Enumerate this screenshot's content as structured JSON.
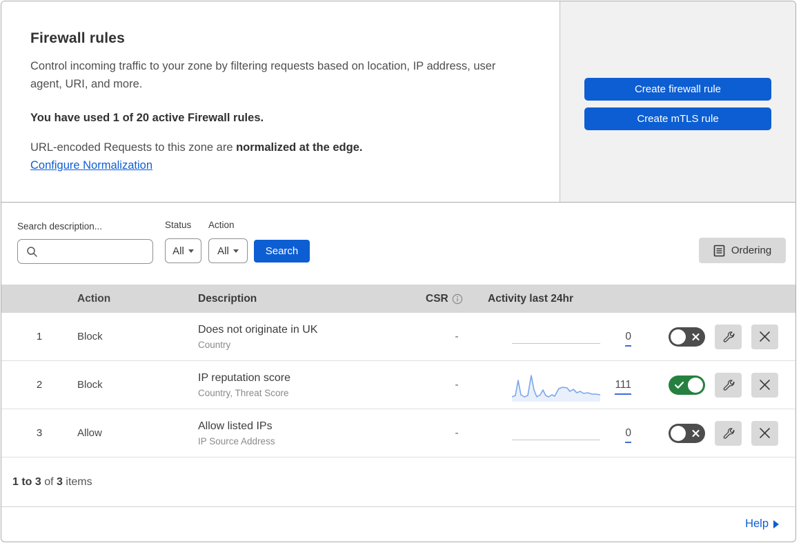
{
  "hero": {
    "title": "Firewall rules",
    "description": "Control incoming traffic to your zone by filtering requests based on location, IP address, user agent, URI, and more.",
    "usage_bold": "You have used 1 of 20 active Firewall rules.",
    "normalization_prefix": "URL-encoded Requests to this zone are ",
    "normalization_bold": "normalized at the edge.",
    "normalization_link": "Configure Normalization",
    "buttons": {
      "create_firewall": "Create firewall rule",
      "create_mtls": "Create mTLS rule"
    }
  },
  "filters": {
    "search_label": "Search description...",
    "search_value": "",
    "status_label": "Status",
    "status_value": "All",
    "action_label": "Action",
    "action_value": "All",
    "search_button": "Search",
    "ordering_button": "Ordering"
  },
  "table": {
    "headers": {
      "action": "Action",
      "description": "Description",
      "csr": "CSR",
      "activity": "Activity last 24hr"
    },
    "rows": [
      {
        "num": "1",
        "action": "Block",
        "description": "Does not originate in UK",
        "sub": "Country",
        "csr": "-",
        "activity_count": "0",
        "enabled": false,
        "sparkline": ""
      },
      {
        "num": "2",
        "action": "Block",
        "description": "IP reputation score",
        "sub": "Country, Threat Score",
        "csr": "-",
        "activity_count": "111",
        "enabled": true,
        "sparkline": "0,37 5,35 9,13 13,34 18,37 23,35 28,6 32,27 36,37 41,34 45,27 49,35 53,37 58,34 62,36 68,25 74,23 80,24 84,29 89,26 94,31 99,29 104,32 110,31 116,33 122,33 128,34"
      },
      {
        "num": "3",
        "action": "Allow",
        "description": "Allow listed IPs",
        "sub": "IP Source Address",
        "csr": "-",
        "activity_count": "0",
        "enabled": false,
        "sparkline": ""
      }
    ]
  },
  "footer": {
    "range_bold": "1 to 3",
    "of_text": " of ",
    "total_bold": "3",
    "items_text": " items",
    "help_label": "Help"
  },
  "colors": {
    "primary_blue": "#0d5ed2",
    "toggle_green": "#26803f",
    "toggle_off": "#4d4d4d",
    "spark_line": "#7aa5ec",
    "spark_fill": "#e9f0fc"
  }
}
